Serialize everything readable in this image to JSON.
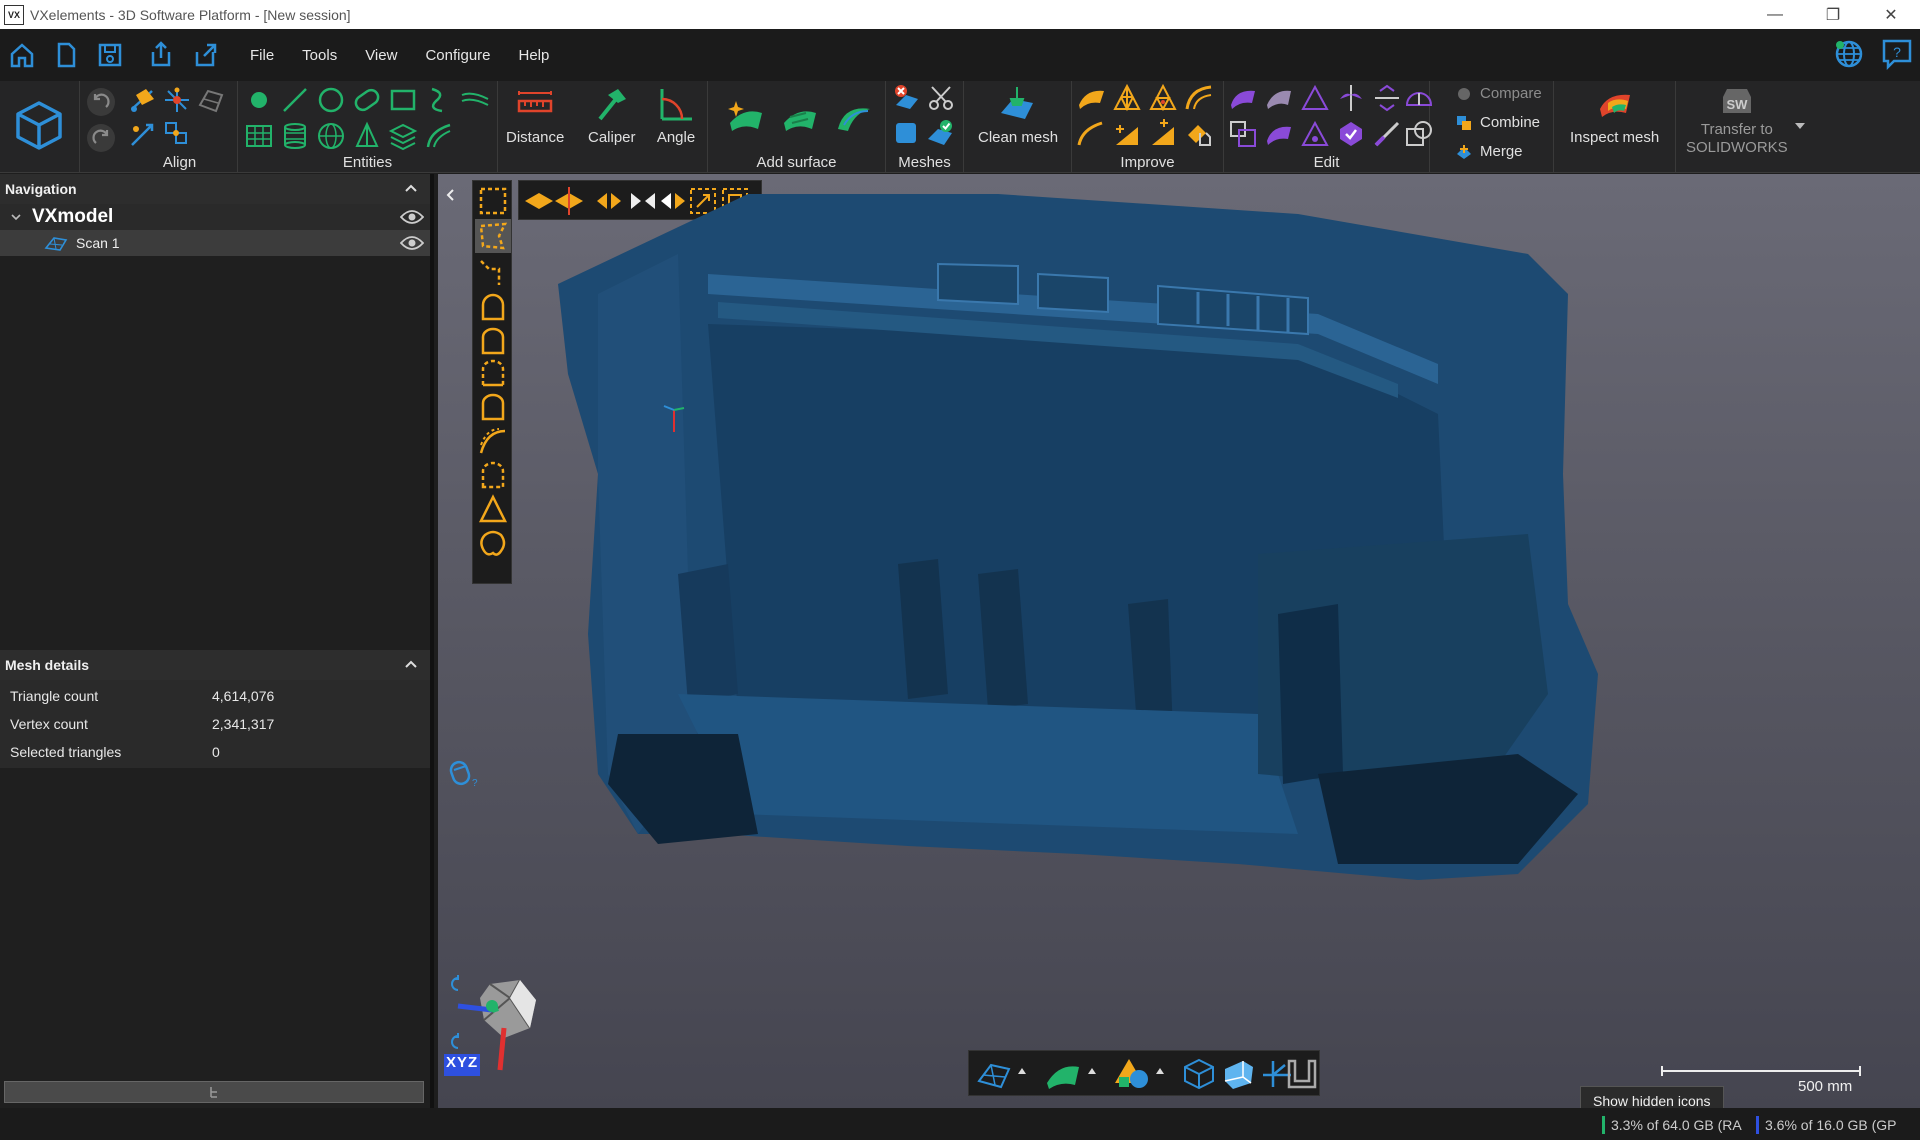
{
  "titlebar": {
    "app_icon_text": "VX",
    "title": "VXelements - 3D Software Platform - [New session]"
  },
  "menu": {
    "items": [
      "File",
      "Tools",
      "View",
      "Configure",
      "Help"
    ]
  },
  "ribbon": {
    "groups": {
      "align": "Align",
      "entities": "Entities",
      "add_surface": "Add surface",
      "meshes": "Meshes",
      "improve": "Improve",
      "edit": "Edit"
    },
    "buttons": {
      "distance": "Distance",
      "caliper": "Caliper",
      "angle": "Angle",
      "clean_mesh": "Clean mesh",
      "compare": "Compare",
      "combine": "Combine",
      "merge": "Merge",
      "inspect_mesh": "Inspect mesh",
      "transfer_line1": "Transfer to",
      "transfer_line2": "SOLIDWORKS",
      "sw_badge": "SW"
    }
  },
  "navigation": {
    "title": "Navigation",
    "root": "VXmodel",
    "child": "Scan 1"
  },
  "mesh_details": {
    "title": "Mesh details",
    "rows": [
      {
        "label": "Triangle count",
        "value": "4,614,076"
      },
      {
        "label": "Vertex count",
        "value": "2,341,317"
      },
      {
        "label": "Selected triangles",
        "value": "0"
      }
    ]
  },
  "viewport": {
    "scale_label": "500 mm",
    "orient_label": "XYZ",
    "tooltip": "Show hidden icons"
  },
  "status": {
    "ram": "3.3% of 64.0 GB (RA",
    "gpu": "3.6% of 16.0 GB (GP"
  },
  "colors": {
    "accent_blue": "#2e8fd8",
    "accent_green": "#22b36a",
    "accent_orange": "#f2a71b",
    "accent_purple": "#8a4ad8",
    "mesh_blue": "#1d4a72"
  }
}
